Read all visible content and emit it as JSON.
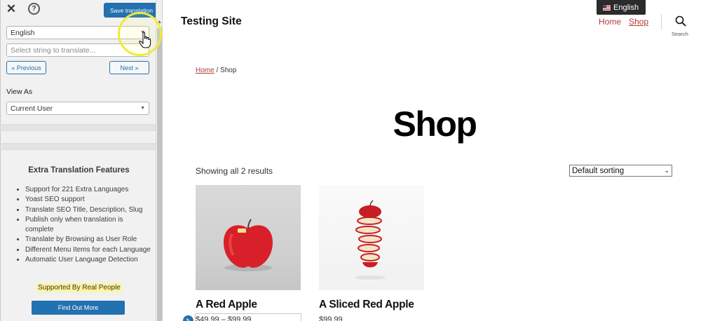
{
  "sidebar": {
    "close_icon": "close-icon",
    "help_label": "?",
    "save_label": "Save translation",
    "language_select": {
      "value": "English"
    },
    "string_select": {
      "placeholder": "Select string to translate..."
    },
    "prev_label": "« Previous",
    "next_label": "Next »",
    "view_as_label": "View As",
    "view_as_select": {
      "value": "Current User"
    },
    "features": {
      "title": "Extra Translation Features",
      "items": [
        "Support for 221 Extra Languages",
        "Yoast SEO support",
        "Translate SEO Title, Description, Slug",
        "Publish only when translation is complete",
        "Translate by Browsing as User Role",
        "Different Menu Items for each Language",
        "Automatic User Language Detection"
      ],
      "supported_label": "Supported By Real People",
      "find_out_label": "Find Out More"
    }
  },
  "site": {
    "title": "Testing Site",
    "language_switcher": "English",
    "nav": {
      "home": "Home",
      "shop": "Shop"
    },
    "search_label": "Search",
    "breadcrumb": {
      "home": "Home",
      "separator": " / ",
      "current": "Shop"
    },
    "page_title": "Shop",
    "results_count": "Showing all 2 results",
    "sorting": "Default sorting",
    "products": [
      {
        "name": "A Red Apple",
        "price": "$49.99 – $99.99"
      },
      {
        "name": "A Sliced Red Apple",
        "price": "$99.99"
      }
    ]
  },
  "colors": {
    "accent_blue": "#2271b1",
    "link_red": "#b23939",
    "highlight_yellow": "#fff5a0",
    "cursor_ring": "#f0ea3a"
  }
}
